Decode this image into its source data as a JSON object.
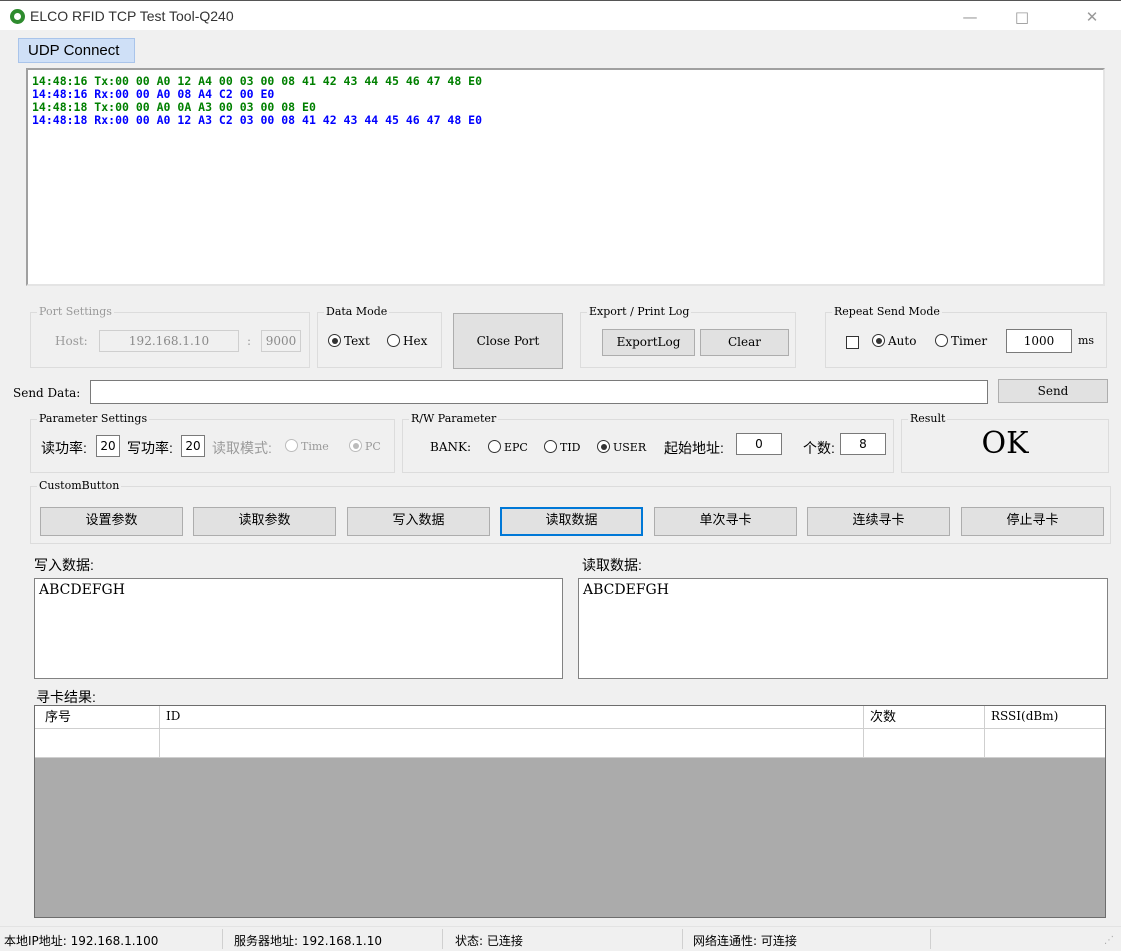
{
  "window": {
    "title": "ELCO RFID TCP Test Tool-Q240",
    "minimize": "—",
    "maximize": "□",
    "close": "✕"
  },
  "tab": {
    "label": "UDP Connect"
  },
  "log": [
    {
      "text": "14:48:16 Tx:00 00 A0 12 A4 00 03 00 08 41 42 43 44 45 46 47 48 E0",
      "kind": "tx"
    },
    {
      "text": "14:48:16 Rx:00 00 A0 08 A4 C2 00 E0",
      "kind": "rx"
    },
    {
      "text": "14:48:18 Tx:00 00 A0 0A A3 00 03 00 08 E0",
      "kind": "tx"
    },
    {
      "text": "14:48:18 Rx:00 00 A0 12 A3 C2 03 00 08 41 42 43 44 45 46 47 48 E0",
      "kind": "rx"
    }
  ],
  "port_settings": {
    "title": "Port Settings",
    "host_label": "Host:",
    "host_value": "192.168.1.10",
    "colon": ":",
    "port_value": "9000"
  },
  "data_mode": {
    "title": "Data Mode",
    "text_label": "Text",
    "hex_label": "Hex",
    "selected": "Text"
  },
  "close_port": {
    "label": "Close Port"
  },
  "export_log": {
    "title": "Export / Print Log",
    "export_label": "ExportLog",
    "clear_label": "Clear"
  },
  "repeat_send": {
    "title": "Repeat Send Mode",
    "auto_label": "Auto",
    "timer_label": "Timer",
    "interval_value": "1000",
    "unit": "ms",
    "selected": "Auto",
    "enabled": false
  },
  "send": {
    "label": "Send Data:",
    "value": "",
    "button": "Send"
  },
  "param_settings": {
    "title": "Parameter Settings",
    "read_power_label": "读功率:",
    "read_power_value": "20",
    "write_power_label": "写功率:",
    "write_power_value": "20",
    "read_mode_label": "读取模式:",
    "mode_time": "Time",
    "mode_pc": "PC",
    "selected_mode": "PC"
  },
  "rw_param": {
    "title": "R/W Parameter",
    "bank_label": "BANK:",
    "bank_epc": "EPC",
    "bank_tid": "TID",
    "bank_user": "USER",
    "selected_bank": "USER",
    "start_addr_label": "起始地址:",
    "start_addr_value": "0",
    "count_label": "个数:",
    "count_value": "8"
  },
  "result": {
    "title": "Result",
    "value": "OK"
  },
  "custom_buttons": {
    "title": "CustomButton",
    "buttons": [
      "设置参数",
      "读取参数",
      "写入数据",
      "读取数据",
      "单次寻卡",
      "连续寻卡",
      "停止寻卡"
    ],
    "active_index": 3
  },
  "write_data": {
    "label": "写入数据:",
    "value": "ABCDEFGH"
  },
  "read_data": {
    "label": "读取数据:",
    "value": "ABCDEFGH"
  },
  "search_results": {
    "label": "寻卡结果:",
    "columns": [
      "序号",
      "ID",
      "次数",
      "RSSI(dBm)"
    ],
    "rows": [
      [
        "",
        "",
        "",
        ""
      ]
    ]
  },
  "statusbar": {
    "local_ip": "本地IP地址: 192.168.1.100",
    "server_addr": "服务器地址: 192.168.1.10",
    "state": "状态: 已连接",
    "network": "网络连通性: 可连接"
  },
  "colors": {
    "tx": "#008000",
    "rx": "#0000ff",
    "tab_bg": "#cfe0f7",
    "grid_bg": "#ababab",
    "active_button_border": "#0078d7"
  }
}
